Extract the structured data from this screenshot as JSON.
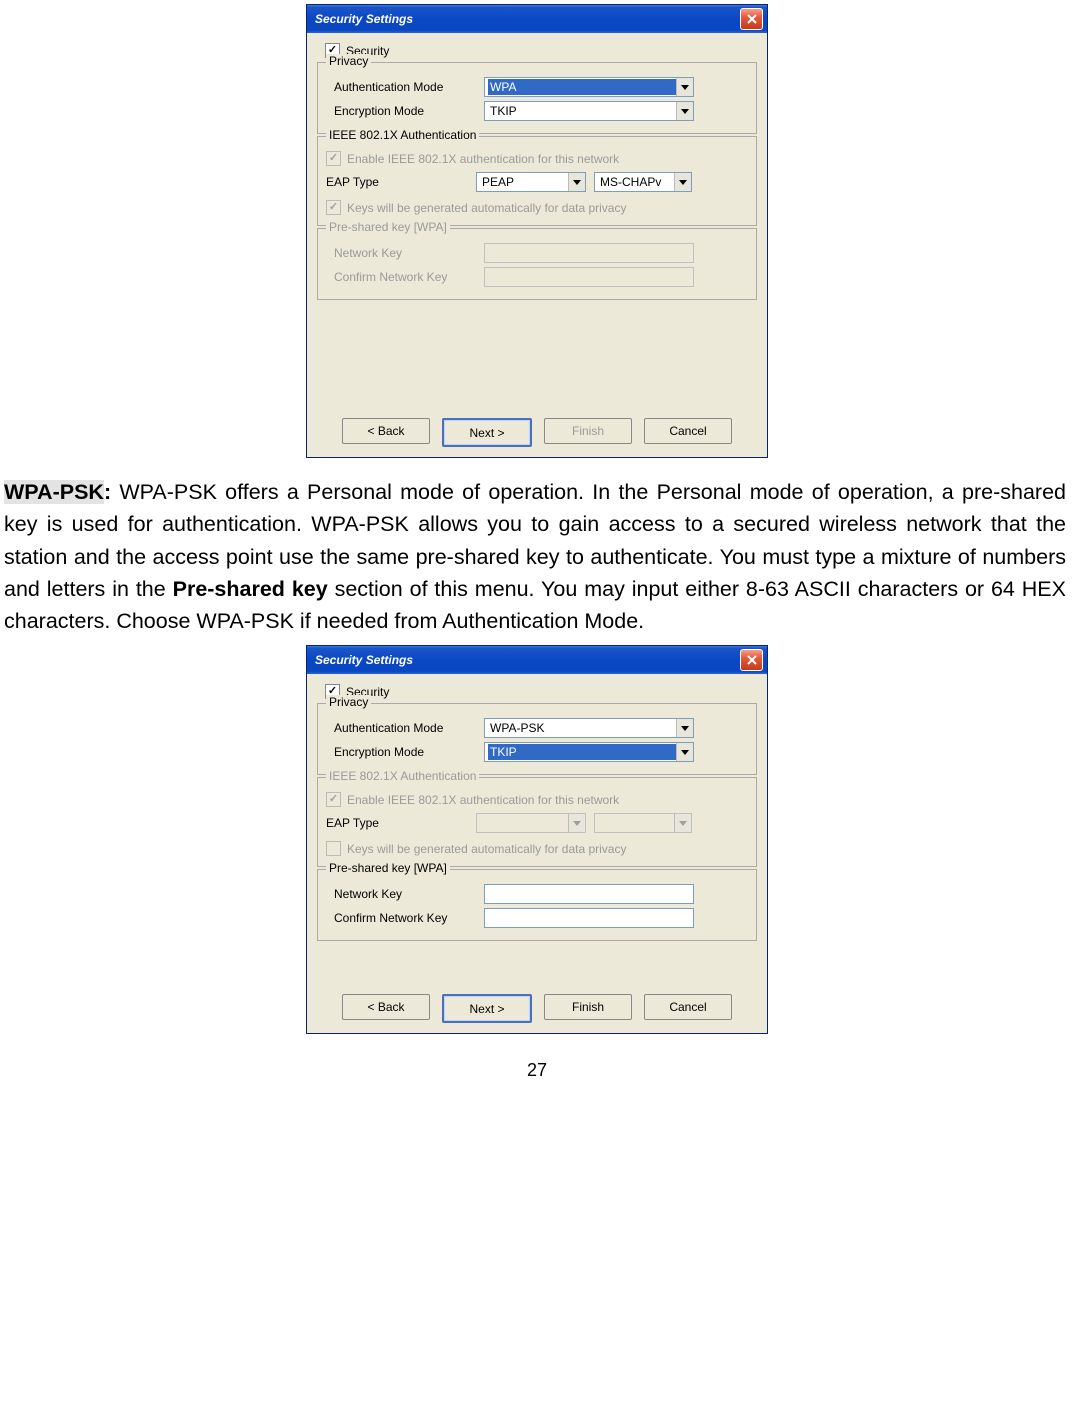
{
  "dialog1": {
    "title": "Security Settings",
    "security_checkbox_label": "Security",
    "privacy_group": "Privacy",
    "auth_mode_label": "Authentication Mode",
    "auth_mode_value": "WPA",
    "enc_mode_label": "Encryption Mode",
    "enc_mode_value": "TKIP",
    "ieee_group": "IEEE 802.1X Authentication",
    "enable_ieee_label": "Enable IEEE 802.1X authentication for this network",
    "eap_type_label": "EAP Type",
    "eap_type_value": "PEAP",
    "eap_sub_value": "MS-CHAPv",
    "keys_gen_label": "Keys will be generated automatically for data privacy",
    "psk_group": "Pre-shared key [WPA]",
    "netkey_label": "Network Key",
    "confkey_label": "Confirm Network Key",
    "back_btn": "< Back",
    "next_btn": "Next >",
    "finish_btn": "Finish",
    "cancel_btn": "Cancel"
  },
  "paragraph": {
    "psk_label": "WPA-PSK",
    "colon": ":",
    "text1": " WPA-PSK offers a Personal mode of operation. In the Personal mode of operation, a pre-shared key is used for authentication. WPA-PSK allows you to gain access to a secured wireless network that the station and the access point use the same pre-shared key to authenticate. You must type a mixture of numbers and letters in the ",
    "psk_bold": "Pre-shared key",
    "text2": " section of this menu. You may input either 8-63 ASCII characters or 64 HEX characters. Choose WPA-PSK if needed from Authentication Mode."
  },
  "dialog2": {
    "title": "Security Settings",
    "security_checkbox_label": "Security",
    "privacy_group": "Privacy",
    "auth_mode_label": "Authentication Mode",
    "auth_mode_value": "WPA-PSK",
    "enc_mode_label": "Encryption Mode",
    "enc_mode_value": "TKIP",
    "ieee_group": "IEEE 802.1X Authentication",
    "enable_ieee_label": "Enable IEEE 802.1X authentication for this network",
    "eap_type_label": "EAP Type",
    "keys_gen_label": "Keys will be generated automatically for data privacy",
    "psk_group": "Pre-shared key [WPA]",
    "netkey_label": "Network Key",
    "confkey_label": "Confirm Network Key",
    "back_btn": "< Back",
    "next_btn": "Next >",
    "finish_btn": "Finish",
    "cancel_btn": "Cancel"
  },
  "page_number": "27"
}
